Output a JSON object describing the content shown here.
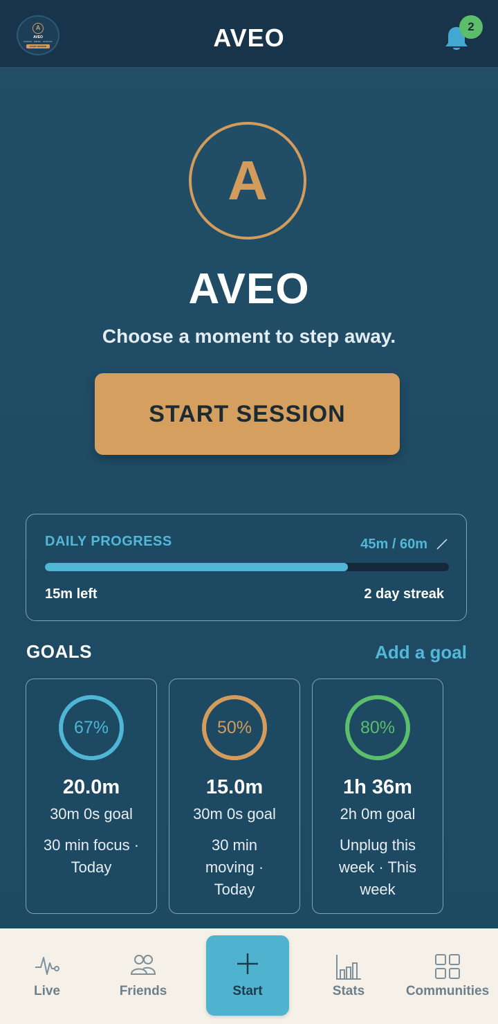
{
  "header": {
    "title": "AVEO",
    "notification_count": "2",
    "avatar": {
      "logo_letter": "A",
      "title": "AVEO",
      "subtitle": "FOCUS · MOVE · UNPLUG",
      "button": "START SESSION"
    }
  },
  "hero": {
    "logo_letter": "A",
    "title": "AVEO",
    "subtitle": "Choose a moment to step away.",
    "start_button": "START SESSION"
  },
  "daily_progress": {
    "label": "DAILY PROGRESS",
    "value": "45m / 60m",
    "fraction": 0.75,
    "remaining": "15m left",
    "streak": "2 day streak"
  },
  "goals": {
    "title": "GOALS",
    "add_label": "Add a goal",
    "items": [
      {
        "percent": "67%",
        "fraction": 0.67,
        "color": "#4fb6d6",
        "value": "20.0m",
        "target": "30m 0s goal",
        "desc": "30 min focus · Today"
      },
      {
        "percent": "50%",
        "fraction": 0.5,
        "color": "#d49c5c",
        "value": "15.0m",
        "target": "30m 0s goal",
        "desc": "30 min moving · Today"
      },
      {
        "percent": "80%",
        "fraction": 0.8,
        "color": "#5cbd6a",
        "value": "1h 36m",
        "target": "2h 0m goal",
        "desc": "Unplug this week · This week"
      }
    ]
  },
  "nav": {
    "live": "Live",
    "friends": "Friends",
    "start": "Start",
    "stats": "Stats",
    "communities": "Communities"
  },
  "colors": {
    "accent": "#4fb6d6",
    "brand_gold": "#d49c5c",
    "success": "#5cbd6a",
    "background": "#1f4a63"
  }
}
